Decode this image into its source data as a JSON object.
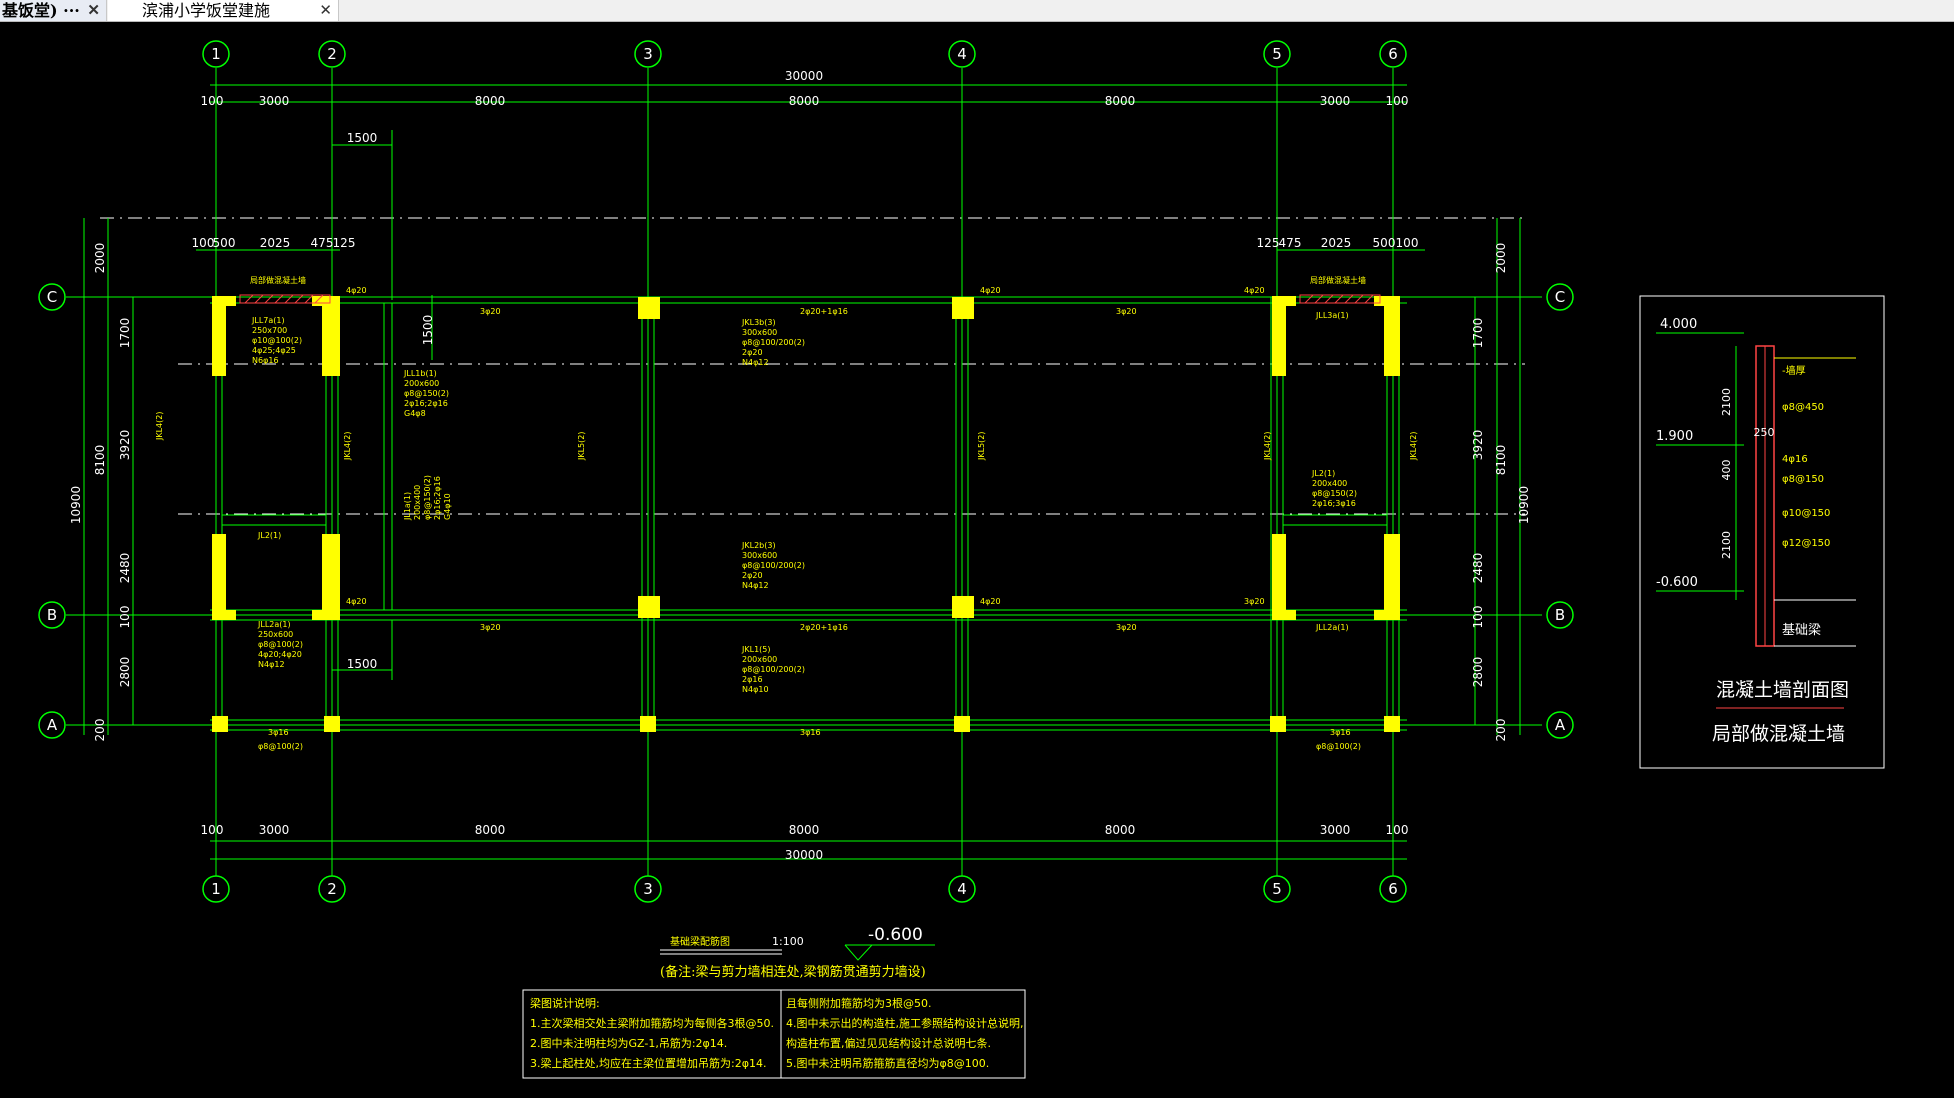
{
  "tabs": [
    {
      "label": "基饭堂) ···",
      "close": "✕"
    },
    {
      "label": "滨浦小学饭堂建施",
      "close": "✕"
    }
  ],
  "colors": {
    "grid": "#00ff00",
    "axis": "#ffffff",
    "text": "#ffffff",
    "beam_note": "#ffff00",
    "column": "#ffff00",
    "cyan": "#00ffff",
    "hatch": "#ff3333"
  },
  "axes": {
    "numbered": [
      "1",
      "2",
      "3",
      "4",
      "5",
      "6"
    ],
    "lettered": [
      "C",
      "B",
      "A"
    ]
  },
  "dims": {
    "top_total": "30000",
    "top_spans": [
      "100",
      "3000",
      "8000",
      "8000",
      "8000",
      "3000",
      "100"
    ],
    "bottom_spans": [
      "100",
      "3000",
      "8000",
      "8000",
      "8000",
      "3000",
      "100"
    ],
    "bottom_total": "30000",
    "d1500_top": "1500",
    "d1500_mid": "1500",
    "d1500_bottom": "1500",
    "left_detail": [
      "100",
      "500",
      "2025",
      "475",
      "125"
    ],
    "right_detail": [
      "125",
      "475",
      "2025",
      "500",
      "100"
    ],
    "left_outer_total": "10900",
    "left_mid": [
      "2000",
      "8100",
      "200"
    ],
    "left_inner": [
      "1700",
      "3920",
      "2480",
      "100",
      "2800"
    ],
    "right_outer_total": "10900",
    "right_mid": [
      "2000",
      "8100",
      "200"
    ],
    "right_inner": [
      "1700",
      "3920",
      "2480",
      "100",
      "2800"
    ]
  },
  "beam_notes": {
    "jll7a": [
      "JLL7a(1)",
      "250x700",
      "φ10@100(2)",
      "4φ25;4φ25",
      "N6φ16"
    ],
    "jll1b": [
      "JLL1b(1)",
      "200x600",
      "φ8@150(2)",
      "2φ16;2φ16",
      "G4φ8"
    ],
    "jl1a": [
      "JL1a(1)",
      "200x400",
      "φ8@150(2)",
      "2φ16;2φ16",
      "G4φ10"
    ],
    "jkl3b": [
      "JKL3b(3)",
      "300x600",
      "φ8@100/200(2)",
      "2φ20",
      "N4φ12"
    ],
    "jkl2b": [
      "JKL2b(3)",
      "300x600",
      "φ8@100/200(2)",
      "2φ20",
      "N4φ12"
    ],
    "jkl1": [
      "JKL1(5)",
      "200x600",
      "φ8@100/200(2)",
      "2φ16",
      "N4φ10"
    ],
    "jll3a": [
      "JLL3a(1)"
    ],
    "jl2_right": [
      "JL2(1)",
      "200x400",
      "φ8@150(2)",
      "2φ16;3φ16"
    ],
    "jll2a_left": [
      "JLL2a(1)",
      "250x600",
      "φ8@100(2)",
      "4φ20;4φ20",
      "N4φ12"
    ],
    "jll2a_right": [
      "JLL2a(1)"
    ],
    "jl2_left": "JL2(1)",
    "jkl4_left": "JKL4(2)",
    "jkl4_left2": "JKL4(2)",
    "jkl5_mid": "JKL5(2)",
    "jkl5_mid2": "JKL5(2)",
    "jkl4_right": "JKL4(2)",
    "jkl4_right2": "JKL4(2)",
    "rebar_3phi20": "3φ20",
    "rebar_2phi20_1phi16": "2φ20+1φ16",
    "rebar_3phi16": "3φ16",
    "rebar_4phi20": "4φ20",
    "rebar_phi8_100": "φ8@100(2)",
    "wall_label_left": "局部做混凝土墙",
    "wall_label_right": "局部做混凝土墙"
  },
  "section": {
    "elevations": [
      "4.000",
      "1.900",
      "-0.600"
    ],
    "dims": [
      "2100",
      "250",
      "400",
      "2100"
    ],
    "rebars": [
      "-墙厚",
      "φ8@450",
      "4φ16",
      "φ8@150",
      "φ10@150",
      "φ12@150"
    ],
    "foundation": "基础梁",
    "title": "混凝土墙剖面图",
    "subtitle": "局部做混凝土墙"
  },
  "drawing": {
    "title": "基础梁配筋图",
    "scale": "1:100",
    "elevation": "-0.600",
    "remark": "(备注:梁与剪力墙相连处,梁钢筋贯通剪力墙设)"
  },
  "notes": {
    "left": [
      "梁图说计说明:",
      "1.主次梁相交处主梁附加箍筋均为每侧各3根@50.",
      "2.图中未注明柱均为GZ-1,吊筋为:2φ14.",
      "3.梁上起柱处,均应在主梁位置增加吊筋为:2φ14."
    ],
    "right": [
      "且每侧附加箍筋均为3根@50.",
      "4.图中未示出的构造柱,施工参照结构设计总说明,",
      "  构造柱布置,偏过见见结构设计总说明七条.",
      "5.图中未注明吊筋箍筋直径均为φ8@100."
    ]
  }
}
